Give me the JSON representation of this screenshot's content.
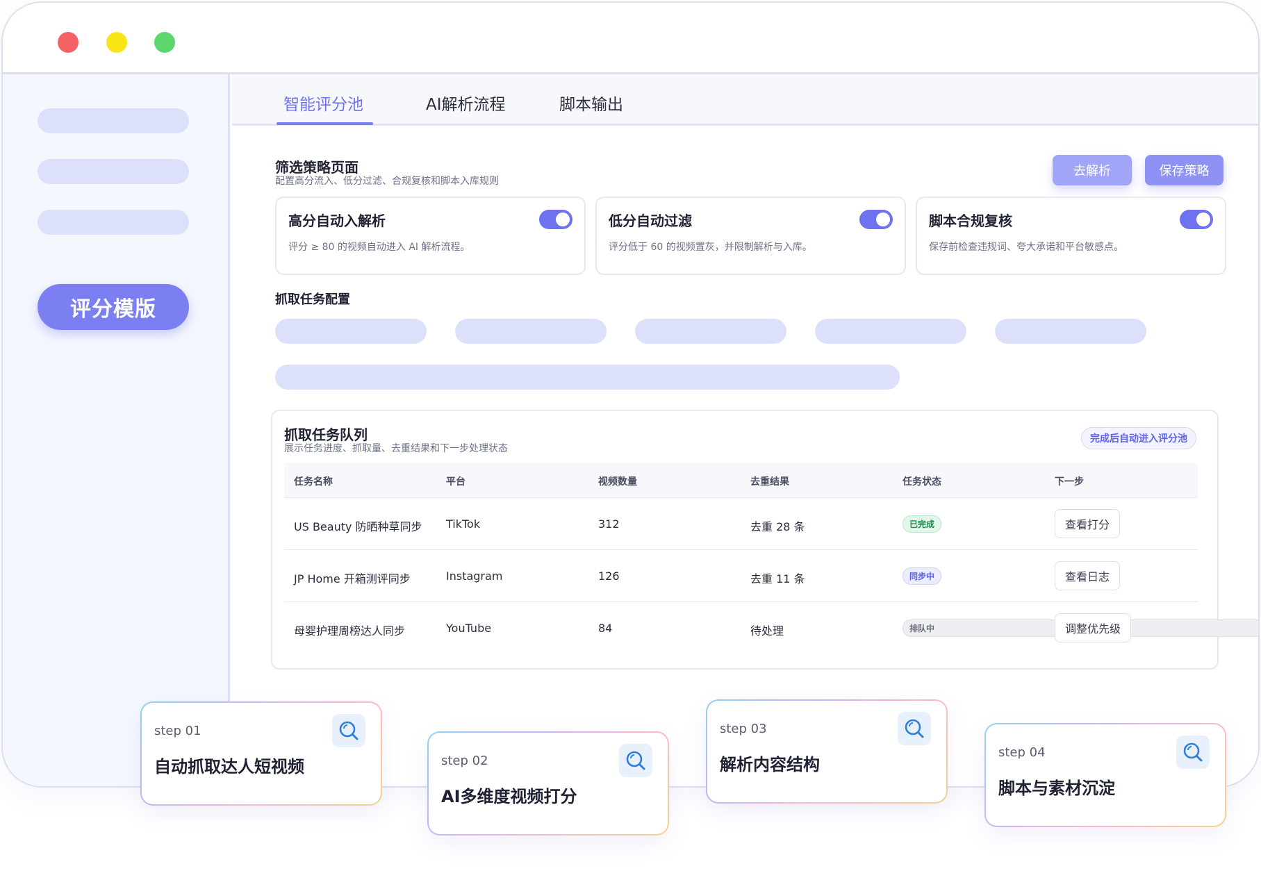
{
  "tabs": [
    {
      "label": "智能评分池",
      "active": true
    },
    {
      "label": "AI解析流程",
      "active": false
    },
    {
      "label": "脚本输出",
      "active": false
    }
  ],
  "sidebar": {
    "active_label": "评分模版"
  },
  "strategy": {
    "title": "筛选策略页面",
    "subtitle": "配置高分流入、低分过滤、合规复核和脚本入库规则",
    "buttons": {
      "parse": "去解析",
      "save": "保存策略"
    },
    "cards": [
      {
        "title": "高分自动入解析",
        "desc": "评分 ≥ 80 的视频自动进入 AI 解析流程。",
        "enabled": true
      },
      {
        "title": "低分自动过滤",
        "desc": "评分低于 60 的视频置灰，并限制解析与入库。",
        "enabled": true
      },
      {
        "title": "脚本合规复核",
        "desc": "保存前检查违规词、夸大承诺和平台敏感点。",
        "enabled": true
      }
    ]
  },
  "crawl_config": {
    "title": "抓取任务配置"
  },
  "queue": {
    "title": "抓取任务队列",
    "subtitle": "展示任务进度、抓取量、去重结果和下一步处理状态",
    "badge": "完成后自动进入评分池",
    "columns": [
      "任务名称",
      "平台",
      "视频数量",
      "去重结果",
      "任务状态",
      "下一步"
    ],
    "rows": [
      {
        "name": "US Beauty 防晒种草同步",
        "platform": "TikTok",
        "count": "312",
        "dedup": "去重 28 条",
        "status": "已完成",
        "status_type": "done",
        "action": "查看打分"
      },
      {
        "name": "JP Home 开箱测评同步",
        "platform": "Instagram",
        "count": "126",
        "dedup": "去重 11 条",
        "status": "同步中",
        "status_type": "sync",
        "action": "查看日志"
      },
      {
        "name": "母婴护理周榜达人同步",
        "platform": "YouTube",
        "count": "84",
        "dedup": "待处理",
        "status": "排队中",
        "status_type": "queue",
        "action": "调整优先级"
      }
    ]
  },
  "steps": [
    {
      "label": "step 01",
      "title": "自动抓取达人短视频",
      "icon": "search-icon"
    },
    {
      "label": "step 02",
      "title": "AI多维度视频打分",
      "icon": "search-icon"
    },
    {
      "label": "step 03",
      "title": "解析内容结构",
      "icon": "search-icon"
    },
    {
      "label": "step 04",
      "title": "脚本与素材沉淀",
      "icon": "search-icon"
    }
  ],
  "colors": {
    "accent": "#7b7ff2",
    "placeholder": "#dde0fb",
    "status_done": "#1f8a4c",
    "status_sync": "#5a5fe6",
    "status_queue": "#6a6d7a"
  }
}
